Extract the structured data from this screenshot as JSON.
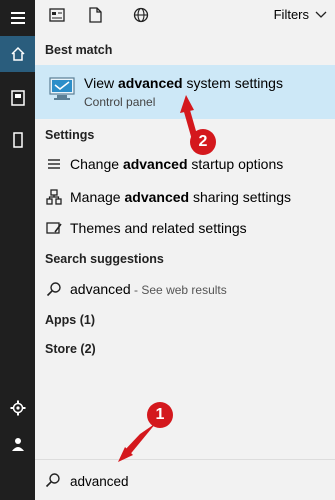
{
  "topbar": {
    "filters_label": "Filters",
    "icons": [
      "document-layout-icon",
      "file-icon",
      "globe-icon"
    ]
  },
  "best_match": {
    "header": "Best match",
    "title_pre": "View ",
    "title_bold": "advanced",
    "title_post": " system settings",
    "subtitle": "Control panel"
  },
  "settings": {
    "header": "Settings",
    "items": [
      {
        "pre": "Change ",
        "bold": "advanced",
        "post": " startup options"
      },
      {
        "pre": "Manage ",
        "bold": "advanced",
        "post": " sharing settings"
      },
      {
        "pre": "Themes and related settings",
        "bold": "",
        "post": ""
      }
    ]
  },
  "suggestions": {
    "header": "Search suggestions",
    "query": "advanced",
    "suffix": " - See web results"
  },
  "apps_header": "Apps (1)",
  "store_header": "Store (2)",
  "search": {
    "value": "advanced"
  },
  "callouts": [
    "1",
    "2"
  ],
  "colors": {
    "accent_selection": "#cde8f7",
    "rail": "#1f1f1f",
    "rail_active": "#2a5d7d",
    "annotation": "#d4181d"
  }
}
